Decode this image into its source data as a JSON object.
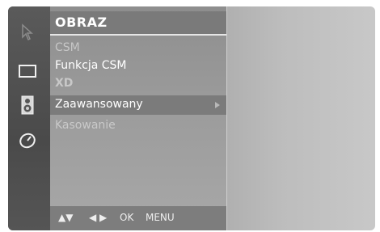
{
  "menu": {
    "title": "OBRAZ",
    "items": [
      {
        "label": "CSM"
      },
      {
        "label": "Funkcja CSM"
      },
      {
        "label": "XD"
      },
      {
        "label": "Zaawansowany"
      },
      {
        "label": "Kasowanie"
      }
    ],
    "selected_index": 3
  },
  "nav": {
    "updown": "▲▼",
    "leftright": "◀ ▶",
    "ok": "OK",
    "menu": "MENU"
  },
  "icons": [
    "cursor-icon",
    "screen-icon",
    "speaker-icon",
    "clock-icon"
  ],
  "colors": {
    "icon_column": "#4f4f4f",
    "panel": "#9a9a9a",
    "selected_row": "#7b7b7b",
    "text": "#ffffff"
  }
}
